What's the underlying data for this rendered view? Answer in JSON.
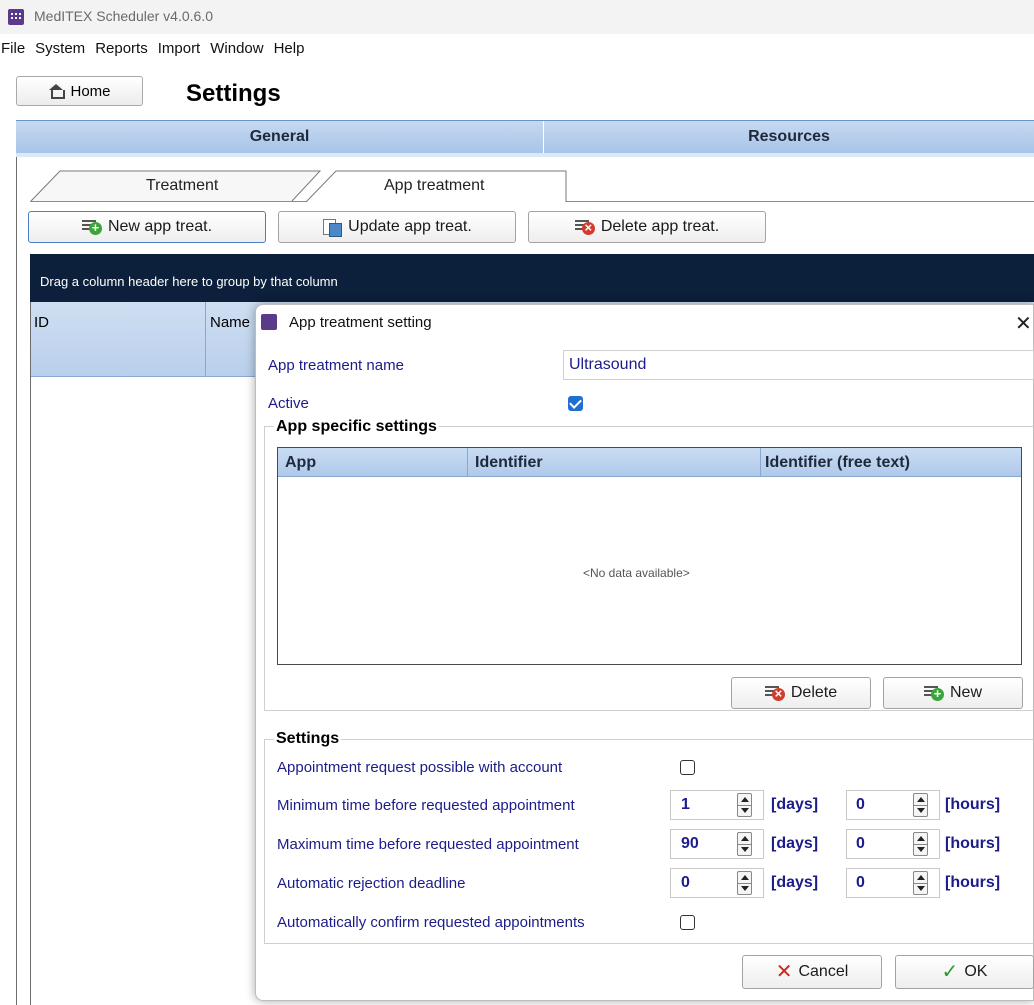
{
  "window": {
    "title": "MedITEX Scheduler v4.0.6.0"
  },
  "menu": [
    "File",
    "System",
    "Reports",
    "Import",
    "Window",
    "Help"
  ],
  "home": {
    "label": "Home"
  },
  "page": {
    "title": "Settings"
  },
  "sections": {
    "general": "General",
    "resources": "Resources"
  },
  "subtabs": {
    "treatment": "Treatment",
    "app_treatment": "App treatment"
  },
  "toolbar": {
    "new": "New app treat.",
    "update": "Update app treat.",
    "delete": "Delete app treat."
  },
  "grid": {
    "group_hint": "Drag a column header here to group by that column",
    "columns": [
      "ID",
      "Name"
    ]
  },
  "dialog": {
    "title": "App treatment setting",
    "name_label": "App treatment name",
    "name_value": "Ultrasound",
    "active_label": "Active",
    "active_checked": true,
    "app_specific": {
      "title": "App specific settings",
      "columns": [
        "App",
        "Identifier",
        "Identifier (free text)"
      ],
      "rows": [],
      "empty_text": "<No data available>",
      "delete_label": "Delete",
      "new_label": "New"
    },
    "settings": {
      "title": "Settings",
      "request_label": "Appointment request possible with account",
      "request_checked": false,
      "min_label": "Minimum time before requested appointment",
      "min_days": "1",
      "min_hours": "0",
      "max_label": "Maximum time before requested appointment",
      "max_days": "90",
      "max_hours": "0",
      "reject_label": "Automatic rejection deadline",
      "reject_days": "0",
      "reject_hours": "0",
      "confirm_label": "Automatically confirm requested appointments",
      "confirm_checked": false,
      "days_unit": "[days]",
      "hours_unit": "[hours]"
    },
    "cancel_label": "Cancel",
    "ok_label": "OK"
  }
}
